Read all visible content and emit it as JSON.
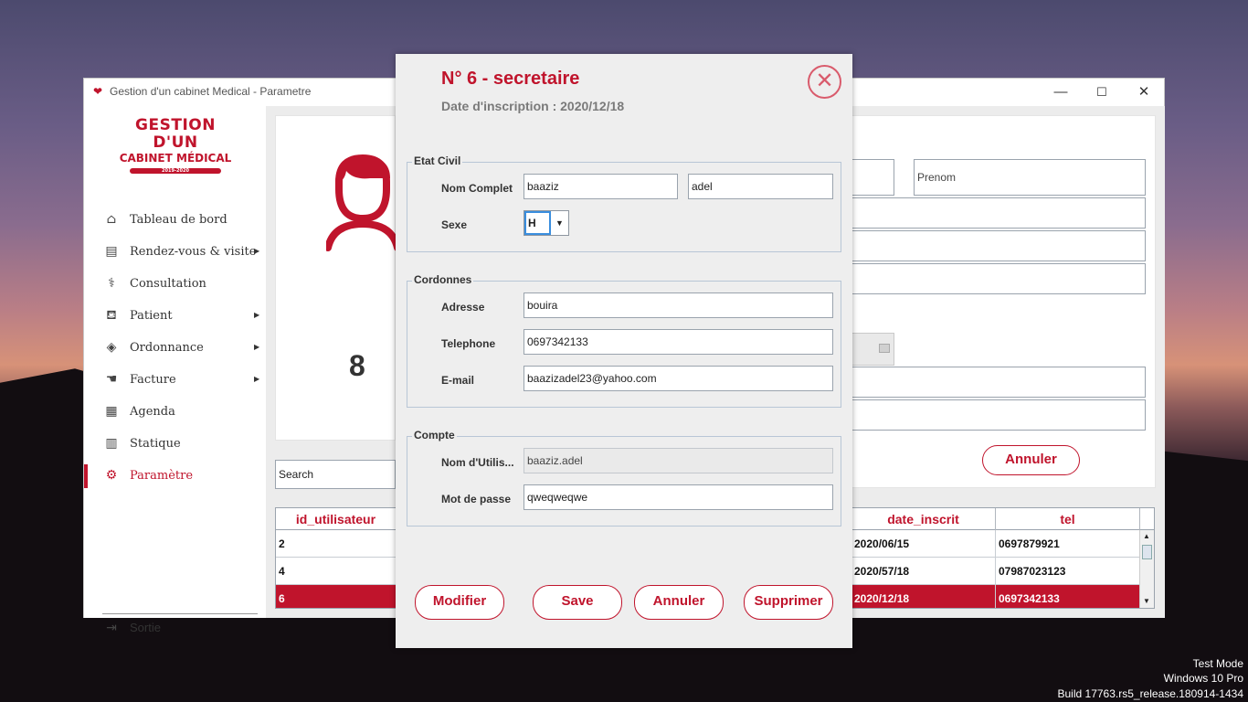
{
  "window": {
    "title": "Gestion d'un cabinet Medical - Parametre",
    "minimize": "—",
    "maximize": "☐",
    "close": "✕"
  },
  "logo": {
    "line1": "GESTION D'UN",
    "line2": "CABINET MÉDICAL",
    "line3": "2019-2020"
  },
  "sidebar": {
    "items": [
      {
        "label": "Tableau de bord",
        "icon": "home-icon",
        "glyph": "⌂",
        "arrow": ""
      },
      {
        "label": "Rendez-vous & visite",
        "icon": "document-icon",
        "glyph": "▤",
        "arrow": "▶"
      },
      {
        "label": "Consultation",
        "icon": "stethoscope-icon",
        "glyph": "⚕",
        "arrow": ""
      },
      {
        "label": "Patient",
        "icon": "bed-icon",
        "glyph": "⛾",
        "arrow": "▶"
      },
      {
        "label": "Ordonnance",
        "icon": "pill-icon",
        "glyph": "◈",
        "arrow": "▶"
      },
      {
        "label": "Facture",
        "icon": "money-hand-icon",
        "glyph": "☚",
        "arrow": "▶"
      },
      {
        "label": "Agenda",
        "icon": "calendar-icon",
        "glyph": "▦",
        "arrow": ""
      },
      {
        "label": "Statique",
        "icon": "bar-chart-icon",
        "glyph": "▥",
        "arrow": ""
      },
      {
        "label": "Paramètre",
        "icon": "gear-icon",
        "glyph": "⚙",
        "arrow": ""
      }
    ],
    "active_index": 8,
    "sortie": {
      "label": "Sortie",
      "icon": "exit-icon",
      "glyph": "⇥"
    }
  },
  "background_panel": {
    "count": "8",
    "prenom_placeholder": "Prenom",
    "annuler_label": "Annuler",
    "search_placeholder": "Search",
    "table": {
      "headers": {
        "id": "id_utilisateur",
        "date": "date_inscrit",
        "tel": "tel"
      },
      "rows": [
        {
          "id": "2",
          "date": "2020/06/15",
          "tel": "0697879921",
          "selected": false
        },
        {
          "id": "4",
          "date": "2020/57/18",
          "tel": "07987023123",
          "selected": false
        },
        {
          "id": "6",
          "date": "2020/12/18",
          "tel": "0697342133",
          "selected": true
        }
      ]
    },
    "accent": "#c0142c"
  },
  "dialog": {
    "title": "N° 6 - secretaire",
    "subtitle": "Date d'inscription : 2020/12/18",
    "close_icon": "⊗",
    "etat_civil": {
      "legend": "Etat Civil",
      "nom_label": "Nom Complet",
      "nom_value": "baaziz",
      "prenom_value": "adel",
      "sexe_label": "Sexe",
      "sexe_value": "H",
      "sexe_caret": "▼"
    },
    "cordonnes": {
      "legend": "Cordonnes",
      "adresse_label": "Adresse",
      "adresse_value": "bouira",
      "telephone_label": "Telephone",
      "telephone_value": "0697342133",
      "email_label": "E-mail",
      "email_value": "baazizadel23@yahoo.com"
    },
    "compte": {
      "legend": "Compte",
      "username_label": "Nom d'Utilis...",
      "username_value": "baaziz.adel",
      "password_label": "Mot de passe",
      "password_value": "qweqweqwe"
    },
    "buttons": {
      "modifier": "Modifier",
      "save": "Save",
      "annuler": "Annuler",
      "supprimer": "Supprimer"
    }
  },
  "desktop": {
    "line1": "Test Mode",
    "line2": "Windows 10 Pro",
    "line3": "Build 17763.rs5_release.180914-1434"
  }
}
